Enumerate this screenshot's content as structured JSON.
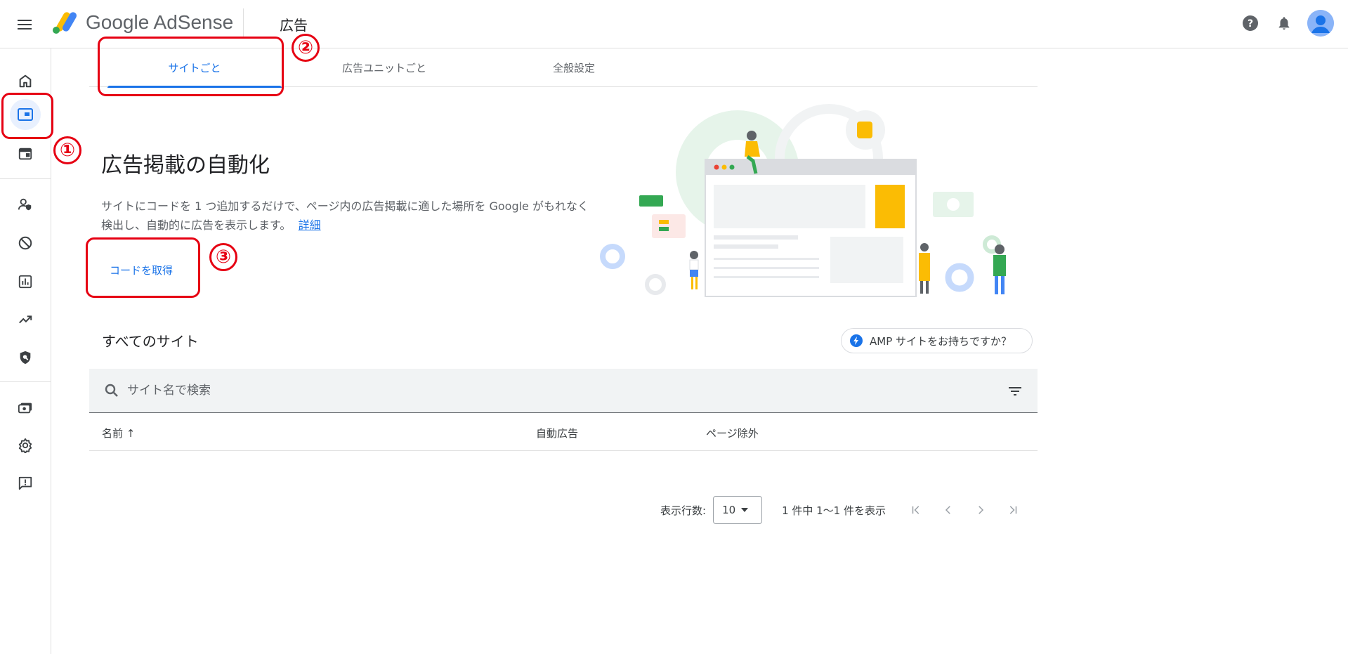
{
  "app": {
    "brand": "Google AdSense",
    "page_title": "広告"
  },
  "tabs": [
    {
      "label": "サイトごと",
      "active": true
    },
    {
      "label": "広告ユニットごと",
      "active": false
    },
    {
      "label": "全般設定",
      "active": false
    }
  ],
  "hero": {
    "title": "広告掲載の自動化",
    "description": "サイトにコードを 1 つ追加するだけで、ページ内の広告掲載に適した場所を Google がもれなく検出し、自動的に広告を表示します。",
    "details_link": "詳細",
    "get_code_label": "コードを取得"
  },
  "annotations": [
    "①",
    "②",
    "③"
  ],
  "sites_section": {
    "title": "すべてのサイト",
    "amp_chip_label": "AMP サイトをお持ちですか？"
  },
  "search": {
    "placeholder": "サイト名で検索"
  },
  "table": {
    "columns": [
      "名前 ↑",
      "自動広告",
      "ページ除外"
    ]
  },
  "pagination": {
    "rows_label": "表示行数:",
    "rows_value": "10",
    "range_text": "1 件中 1〜1 件を表示"
  },
  "colors": {
    "accent": "#1a73e8",
    "annotation": "#e60012",
    "rail_active_bg": "#e8f0fe"
  },
  "rail_icons": [
    "home-icon",
    "ads-icon",
    "blocking-ad-units-icon",
    "privacy-messaging-icon",
    "blocking-controls-icon",
    "reports-icon",
    "optimization-icon",
    "brand-safety-icon",
    "payments-icon",
    "settings-icon",
    "feedback-icon"
  ]
}
